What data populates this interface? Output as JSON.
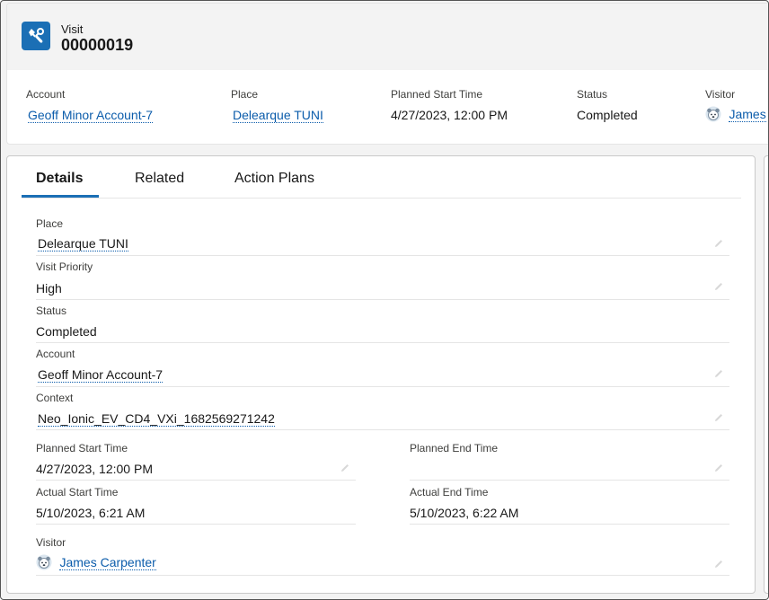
{
  "header": {
    "object_type": "Visit",
    "record_name": "00000019",
    "icon": "visit-tools-icon",
    "icon_color": "#1b6fb5"
  },
  "highlights": [
    {
      "label": "Account",
      "value": "Geoff Minor Account-7"
    },
    {
      "label": "Place",
      "value": "Delearque TUNI"
    },
    {
      "label": "Planned Start Time",
      "value": "4/27/2023, 12:00 PM"
    },
    {
      "label": "Status",
      "value": "Completed"
    },
    {
      "label": "Visitor",
      "value": "James",
      "icon": "user-avatar-icon"
    }
  ],
  "tabs": [
    {
      "label": "Details",
      "active": true
    },
    {
      "label": "Related",
      "active": false
    },
    {
      "label": "Action Plans",
      "active": false
    }
  ],
  "details": {
    "place": {
      "label": "Place",
      "value": "Delearque TUNI"
    },
    "visit_priority": {
      "label": "Visit Priority",
      "value": "High"
    },
    "status": {
      "label": "Status",
      "value": "Completed"
    },
    "account": {
      "label": "Account",
      "value": "Geoff Minor Account-7"
    },
    "context": {
      "label": "Context",
      "value": "Neo_Ionic_EV_CD4_VXi_1682569271242"
    },
    "planned_start": {
      "label": "Planned Start Time",
      "value": "4/27/2023, 12:00 PM"
    },
    "planned_end": {
      "label": "Planned End Time",
      "value": ""
    },
    "actual_start": {
      "label": "Actual Start Time",
      "value": "5/10/2023, 6:21 AM"
    },
    "actual_end": {
      "label": "Actual End Time",
      "value": "5/10/2023, 6:22 AM"
    },
    "visitor": {
      "label": "Visitor",
      "value": "James Carpenter",
      "icon": "user-avatar-icon"
    }
  },
  "colors": {
    "link": "#0b5cab",
    "accent": "#1b6fb5",
    "header_bg": "#f3f3f3"
  }
}
